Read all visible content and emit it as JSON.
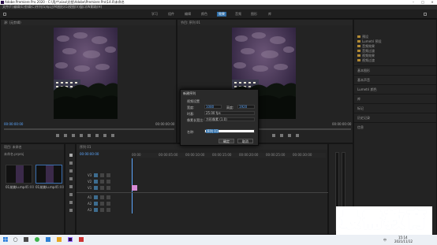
{
  "window": {
    "title": "Adobe Premiere Pro 2020 - C:\\用户\\xiao\\文档\\Adobe\\Premiere Pro\\14.0\\未命名"
  },
  "menus": [
    "文件(F)",
    "编辑(E)",
    "剪辑(C)",
    "序列(S)",
    "标记(M)",
    "图形(G)",
    "视图(V)",
    "窗口(W)",
    "帮助(H)"
  ],
  "workspaces": {
    "items": [
      "学习",
      "组件",
      "编辑",
      "颜色",
      "效果",
      "音频",
      "图形",
      "库"
    ],
    "active": 4
  },
  "source_monitor": {
    "header": "源: (无剪辑)",
    "timecode_left": "00:00:00:00",
    "timecode_right": "00:00:00:00"
  },
  "program_monitor": {
    "header": "节目: 序列 01",
    "timecode_left": "00:00:00:00",
    "timecode_right": "00:00:00:00"
  },
  "right_panel": {
    "items": [
      "预设",
      "Lumetri 预设",
      "音频效果",
      "音频过渡",
      "视频效果",
      "视频过渡"
    ],
    "sections": [
      "基本图形",
      "基本声音",
      "Lumetri 颜色",
      "库",
      "标记",
      "历史记录",
      "信息"
    ]
  },
  "project_panel": {
    "header": "项目: 未命名",
    "file": "未命名.prproj",
    "items": [
      {
        "name": "01湖美lu.mp4",
        "duration": "5:00"
      },
      {
        "name": "01湖美lu.mp4",
        "duration": "5:00"
      }
    ]
  },
  "timeline": {
    "header": "序列 01",
    "timecode": "00:00:00:00",
    "ruler": [
      "00:00",
      "00:00:05:00",
      "00:00:10:00",
      "00:00:15:00",
      "00:00:20:00",
      "00:00:25:00",
      "00:00:30:00",
      "00:00:35:00",
      "00:00:40:00",
      "00:00:45:00",
      "00:00:50:00",
      "00:00:55:00"
    ],
    "tracks": [
      "V3",
      "V2",
      "V1",
      "A1",
      "A2",
      "A3"
    ]
  },
  "dialog": {
    "title": "新建序列",
    "section": "视频设置",
    "width_label": "宽度:",
    "width_value": "1080",
    "height_label": "高度:",
    "height_value": "1920",
    "fps_label": "时基:",
    "fps_value": "25.00 fps",
    "aspect_label": "像素长宽比:",
    "aspect_value": "方形像素 (1.0)",
    "name_label": "名称:",
    "name_value": "序列 01",
    "ok": "确定",
    "cancel": "取消"
  },
  "taskbar": {
    "time": "15:14",
    "date": "2021/11/12",
    "lang": "中"
  },
  "watermark": {
    "text": "最需教育"
  },
  "colors": {
    "accent": "#2f6ea8",
    "timecode": "#5da8ff",
    "watermark": "#1b54b6"
  }
}
